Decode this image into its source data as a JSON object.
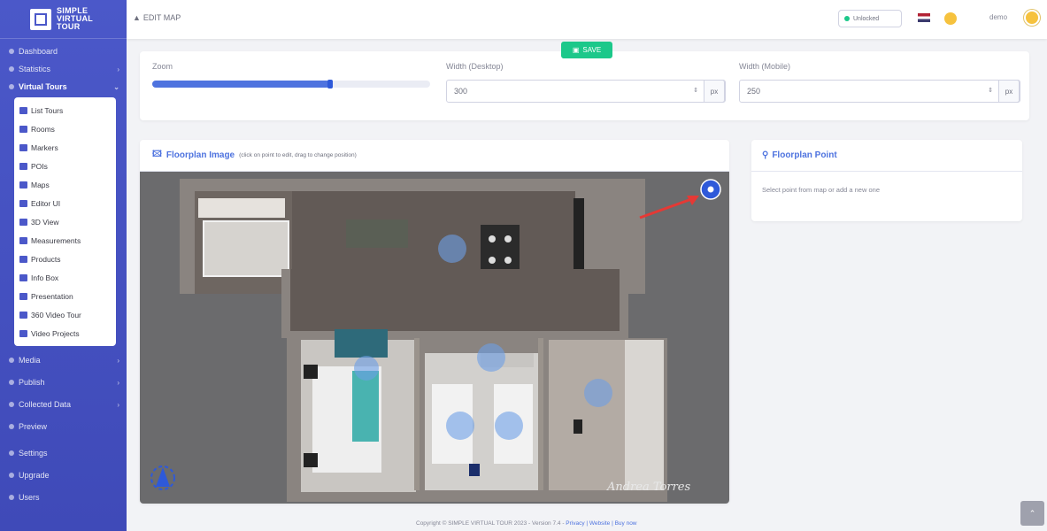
{
  "brand": {
    "line1": "SIMPLE",
    "line2": "VIRTUAL",
    "line3": "TOUR"
  },
  "sidebar": {
    "items_top": [
      {
        "label": "Dashboard",
        "chevron": ""
      },
      {
        "label": "Statistics",
        "chevron": "›"
      },
      {
        "label": "Virtual Tours",
        "chevron": "⌄"
      }
    ],
    "submenu": [
      {
        "label": "List Tours"
      },
      {
        "label": "Rooms"
      },
      {
        "label": "Markers"
      },
      {
        "label": "POIs"
      },
      {
        "label": "Maps"
      },
      {
        "label": "Editor UI"
      },
      {
        "label": "3D View"
      },
      {
        "label": "Measurements"
      },
      {
        "label": "Products"
      },
      {
        "label": "Info Box"
      },
      {
        "label": "Presentation"
      },
      {
        "label": "360 Video Tour"
      },
      {
        "label": "Video Projects"
      }
    ],
    "items_bottom": [
      {
        "label": "Media",
        "chevron": "›"
      },
      {
        "label": "Publish",
        "chevron": "›"
      },
      {
        "label": "Collected Data",
        "chevron": "›"
      },
      {
        "label": "Preview",
        "chevron": ""
      },
      {
        "label": "Settings",
        "chevron": ""
      },
      {
        "label": "Upgrade",
        "chevron": ""
      },
      {
        "label": "Users",
        "chevron": ""
      }
    ]
  },
  "topbar": {
    "title": "EDIT MAP",
    "status": "Unlocked",
    "user": "demo",
    "save_label": "SAVE"
  },
  "settings": {
    "zoom_label": "Zoom",
    "zoom_value": 0.64,
    "width_desktop_label": "Width (Desktop)",
    "width_desktop_value": "300",
    "width_mobile_label": "Width (Mobile)",
    "width_mobile_value": "250",
    "unit": "px"
  },
  "floorplan": {
    "title": "Floorplan Image",
    "hint": "(click on point to edit, drag to change position)",
    "watermark": "Andrea Torres"
  },
  "point_panel": {
    "title": "Floorplan Point",
    "message": "Select point from map or add a new one"
  },
  "footer": {
    "copyright": "Copyright © SIMPLE VIRTUAL TOUR 2023 - Version 7.4 - ",
    "links": "Privacy | Website | Buy now"
  },
  "colors": {
    "sidebar": "#4b58c9",
    "accent": "#4e73df",
    "success": "#1cc88a"
  }
}
